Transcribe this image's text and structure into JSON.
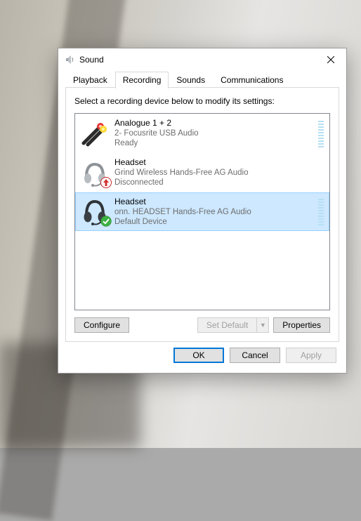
{
  "window": {
    "title": "Sound"
  },
  "tabs": {
    "playback": "Playback",
    "recording": "Recording",
    "sounds": "Sounds",
    "communications": "Communications",
    "active": "recording"
  },
  "recording": {
    "prompt": "Select a recording device below to modify its settings:",
    "devices": [
      {
        "name": "Analogue 1 + 2",
        "desc": "2- Focusrite USB Audio",
        "status": "Ready",
        "icon": "rca-cable",
        "badge": null,
        "meter": true,
        "selected": false
      },
      {
        "name": "Headset",
        "desc": "Grind Wireless Hands-Free AG Audio",
        "status": "Disconnected",
        "icon": "headset",
        "badge": "disconnected",
        "meter": false,
        "selected": false
      },
      {
        "name": "Headset",
        "desc": "onn. HEADSET Hands-Free AG Audio",
        "status": "Default Device",
        "icon": "headset",
        "badge": "default",
        "meter": true,
        "selected": true
      }
    ],
    "buttons": {
      "configure": "Configure",
      "set_default": "Set Default",
      "properties": "Properties"
    }
  },
  "dialog_buttons": {
    "ok": "OK",
    "cancel": "Cancel",
    "apply": "Apply"
  }
}
